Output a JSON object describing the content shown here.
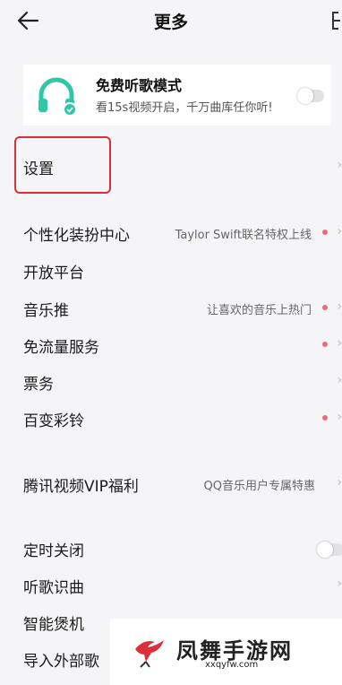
{
  "header": {
    "title": "更多"
  },
  "banner": {
    "title": "免费听歌模式",
    "subtitle": "看15s视频开启，千万曲库任你听!",
    "accent_color": "#2ec8a6",
    "toggle_on": false
  },
  "rows": {
    "settings": {
      "label": "设置"
    },
    "theme_center": {
      "label": "个性化装扮中心",
      "detail": "Taylor Swift联名特权上线"
    },
    "open_platform": {
      "label": "开放平台"
    },
    "music_push": {
      "label": "音乐推",
      "detail": "让喜欢的音乐上热门"
    },
    "free_data": {
      "label": "免流量服务"
    },
    "tickets": {
      "label": "票务"
    },
    "ringtone": {
      "label": "百变彩铃"
    },
    "tencent_vip": {
      "label": "腾讯视频VIP福利",
      "detail": "QQ音乐用户专属特惠"
    },
    "sleep_timer": {
      "label": "定时关闭",
      "toggle_on": false
    },
    "song_recognition": {
      "label": "听歌识曲"
    },
    "smart_device": {
      "label": "智能煲机"
    },
    "import_songs": {
      "label": "导入外部歌"
    }
  },
  "chevron": "›",
  "badge_color": "#ef6a78",
  "highlight_color": "#d9303c",
  "watermark": {
    "text": "凤舞手游网",
    "url": "xxqyfw.com"
  }
}
